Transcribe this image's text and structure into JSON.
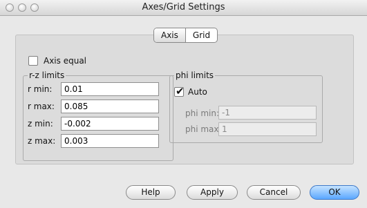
{
  "window": {
    "title": "Axes/Grid Settings"
  },
  "tabs": [
    {
      "label": "Axis"
    },
    {
      "label": "Grid"
    }
  ],
  "axis_equal": {
    "label": "Axis equal",
    "checked": false
  },
  "rz_limits": {
    "title": "r-z limits",
    "fields": [
      {
        "label": "r min:",
        "value": "0.01"
      },
      {
        "label": "r max:",
        "value": "0.085"
      },
      {
        "label": "z min:",
        "value": "-0.002"
      },
      {
        "label": "z max:",
        "value": "0.003"
      }
    ]
  },
  "phi_limits": {
    "title": "phi limits",
    "auto": {
      "label": "Auto",
      "checked": true
    },
    "fields": [
      {
        "label": "phi min:",
        "value": "-1"
      },
      {
        "label": "phi max:",
        "value": "1"
      }
    ]
  },
  "buttons": {
    "help": "Help",
    "apply": "Apply",
    "cancel": "Cancel",
    "ok": "OK"
  },
  "colors": {
    "accent": "#5aa7ff",
    "window_bg": "#e8e8e8"
  }
}
